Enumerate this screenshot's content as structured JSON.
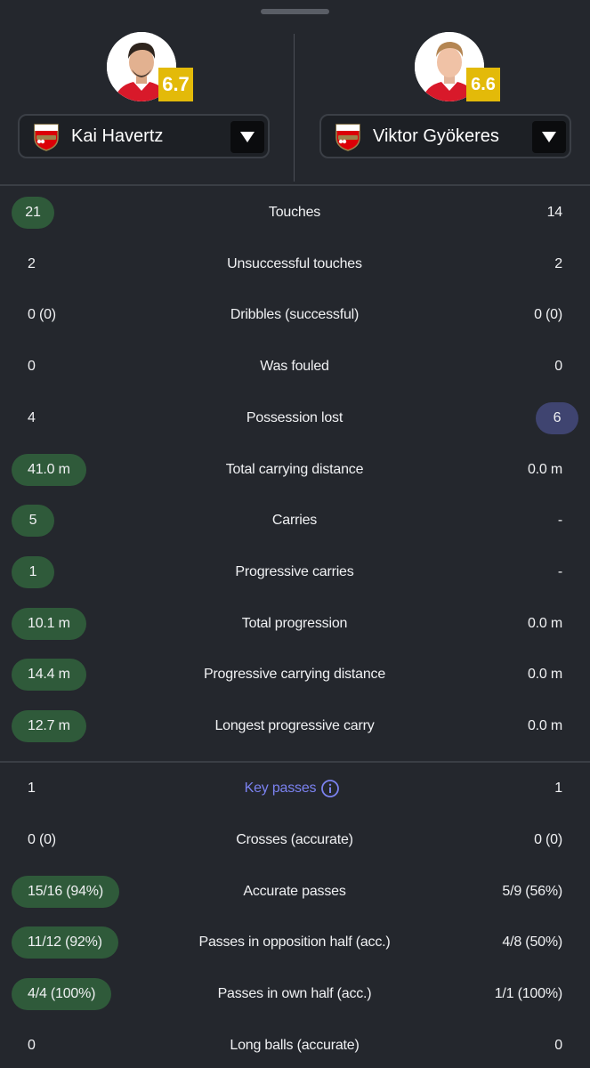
{
  "players": [
    {
      "name": "Kai Havertz",
      "rating": "6.7",
      "club_crest": "arsenal-crest"
    },
    {
      "name": "Viktor Gyökeres",
      "rating": "6.6",
      "club_crest": "arsenal-crest"
    }
  ],
  "colors": {
    "background": "#24272d",
    "rating_badge": "#e3ba09",
    "left_highlight": "#2f5a3a",
    "right_highlight": "#3f4470",
    "link": "#7b82f0"
  },
  "stats_section1": [
    {
      "label": "Touches",
      "left": "21",
      "right": "14",
      "highlight": "left"
    },
    {
      "label": "Unsuccessful touches",
      "left": "2",
      "right": "2",
      "highlight": "none"
    },
    {
      "label": "Dribbles (successful)",
      "left": "0 (0)",
      "right": "0 (0)",
      "highlight": "none"
    },
    {
      "label": "Was fouled",
      "left": "0",
      "right": "0",
      "highlight": "none"
    },
    {
      "label": "Possession lost",
      "left": "4",
      "right": "6",
      "highlight": "right"
    },
    {
      "label": "Total carrying distance",
      "left": "41.0 m",
      "right": "0.0 m",
      "highlight": "left"
    },
    {
      "label": "Carries",
      "left": "5",
      "right": "-",
      "highlight": "left"
    },
    {
      "label": "Progressive carries",
      "left": "1",
      "right": "-",
      "highlight": "left"
    },
    {
      "label": "Total progression",
      "left": "10.1 m",
      "right": "0.0 m",
      "highlight": "left"
    },
    {
      "label": "Progressive carrying distance",
      "left": "14.4 m",
      "right": "0.0 m",
      "highlight": "left"
    },
    {
      "label": "Longest progressive carry",
      "left": "12.7 m",
      "right": "0.0 m",
      "highlight": "left"
    }
  ],
  "stats_section2": [
    {
      "label": "Key passes",
      "left": "1",
      "right": "1",
      "highlight": "none",
      "info": true
    },
    {
      "label": "Crosses (accurate)",
      "left": "0 (0)",
      "right": "0 (0)",
      "highlight": "none"
    },
    {
      "label": "Accurate passes",
      "left": "15/16 (94%)",
      "right": "5/9 (56%)",
      "highlight": "left"
    },
    {
      "label": "Passes in opposition half (acc.)",
      "left": "11/12 (92%)",
      "right": "4/8 (50%)",
      "highlight": "left"
    },
    {
      "label": "Passes in own half (acc.)",
      "left": "4/4 (100%)",
      "right": "1/1 (100%)",
      "highlight": "left"
    },
    {
      "label": "Long balls (accurate)",
      "left": "0",
      "right": "0",
      "highlight": "none"
    }
  ]
}
